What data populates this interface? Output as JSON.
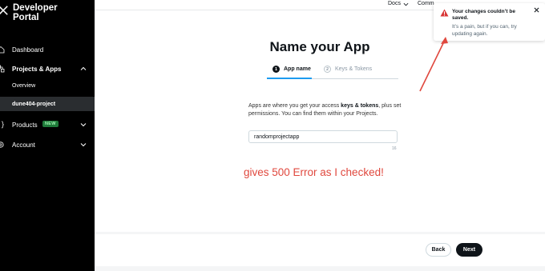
{
  "sidebar": {
    "brand_line1": "Developer",
    "brand_line2": "Portal",
    "items": [
      {
        "label": "Dashboard"
      },
      {
        "label": "Projects & Apps"
      },
      {
        "label": "Overview"
      },
      {
        "label": "dune404-project"
      },
      {
        "label": "Products",
        "badge": "NEW"
      },
      {
        "label": "Account"
      }
    ]
  },
  "topbar": {
    "docs": "Docs",
    "community": "Comm"
  },
  "main": {
    "title": "Name your App",
    "steps": [
      {
        "num": "1",
        "label": "App name"
      },
      {
        "num": "2",
        "label": "Keys & Tokens"
      }
    ],
    "description_pre": "Apps are where you get your access ",
    "description_bold": "keys & tokens",
    "description_post": ", plus set permissions. You can find them within your Projects.",
    "app_name_value": "randomprojectapp",
    "char_counter": "16"
  },
  "annotation": {
    "text": "gives 500 Error as I checked!",
    "color": "#e0483e"
  },
  "footer": {
    "back_label": "Back",
    "next_label": "Next"
  },
  "toast": {
    "title": "Your changes couldn’t be saved.",
    "body": "It’s a pain, but if you can, try updating again."
  },
  "colors": {
    "accent": "#1d9bf0",
    "sidebar_bg": "#000000",
    "error": "#e0483e"
  }
}
